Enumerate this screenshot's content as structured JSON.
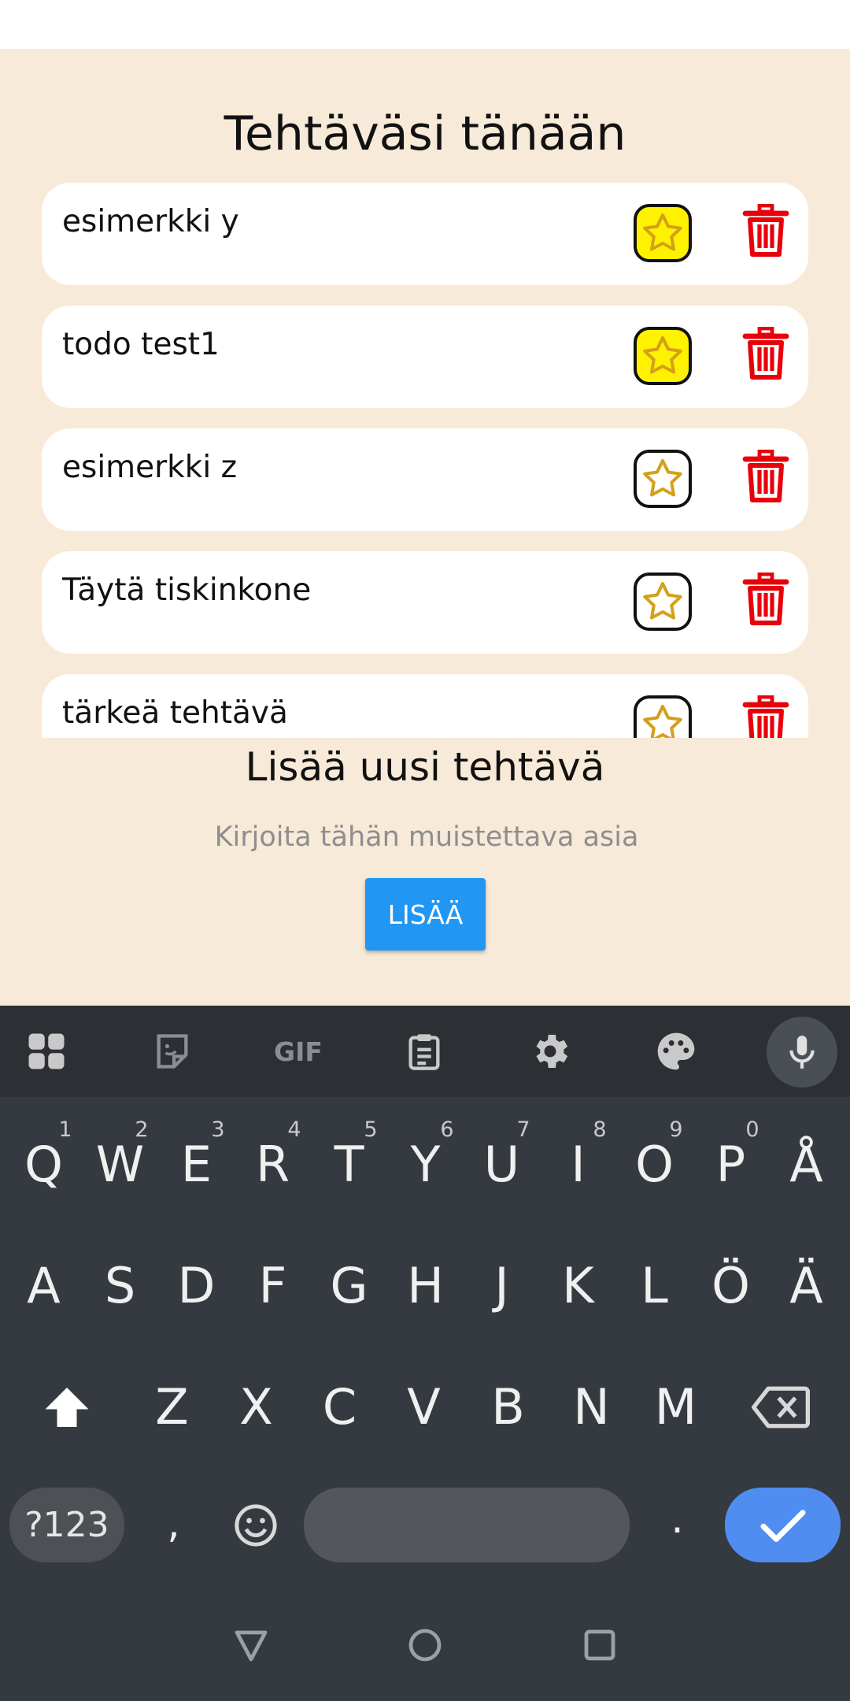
{
  "header": {
    "title": "Tehtäväsi tänään"
  },
  "todos": [
    {
      "text": "esimerkki y",
      "favorite": true
    },
    {
      "text": "todo test1",
      "favorite": true
    },
    {
      "text": "esimerkki z",
      "favorite": false
    },
    {
      "text": "Täytä tiskinkone",
      "favorite": false
    },
    {
      "text": "tärkeä tehtävä",
      "favorite": false
    }
  ],
  "add": {
    "title": "Lisää uusi tehtävä",
    "placeholder": "Kirjoita tähän muistettava asia",
    "button_label": "LISÄÄ"
  },
  "colors": {
    "background": "#f8ead8",
    "favorite": "#fff200",
    "star_outline": "#d4a017",
    "delete": "#e8000b",
    "button": "#2196f3"
  },
  "keyboard": {
    "toolbar_icons": [
      "apps-icon",
      "sticker-icon",
      "gif-icon",
      "clipboard-icon",
      "settings-icon",
      "palette-icon",
      "mic-icon"
    ],
    "gif_label": "GIF",
    "row1": {
      "keys": [
        "Q",
        "W",
        "E",
        "R",
        "T",
        "Y",
        "U",
        "I",
        "O",
        "P",
        "Å"
      ],
      "hints": [
        "1",
        "2",
        "3",
        "4",
        "5",
        "6",
        "7",
        "8",
        "9",
        "0"
      ]
    },
    "row2": [
      "A",
      "S",
      "D",
      "F",
      "G",
      "H",
      "J",
      "K",
      "L",
      "Ö",
      "Ä"
    ],
    "row3": [
      "Z",
      "X",
      "C",
      "V",
      "B",
      "N",
      "M"
    ],
    "symbols_label": "?123",
    "comma": ",",
    "period": "."
  }
}
